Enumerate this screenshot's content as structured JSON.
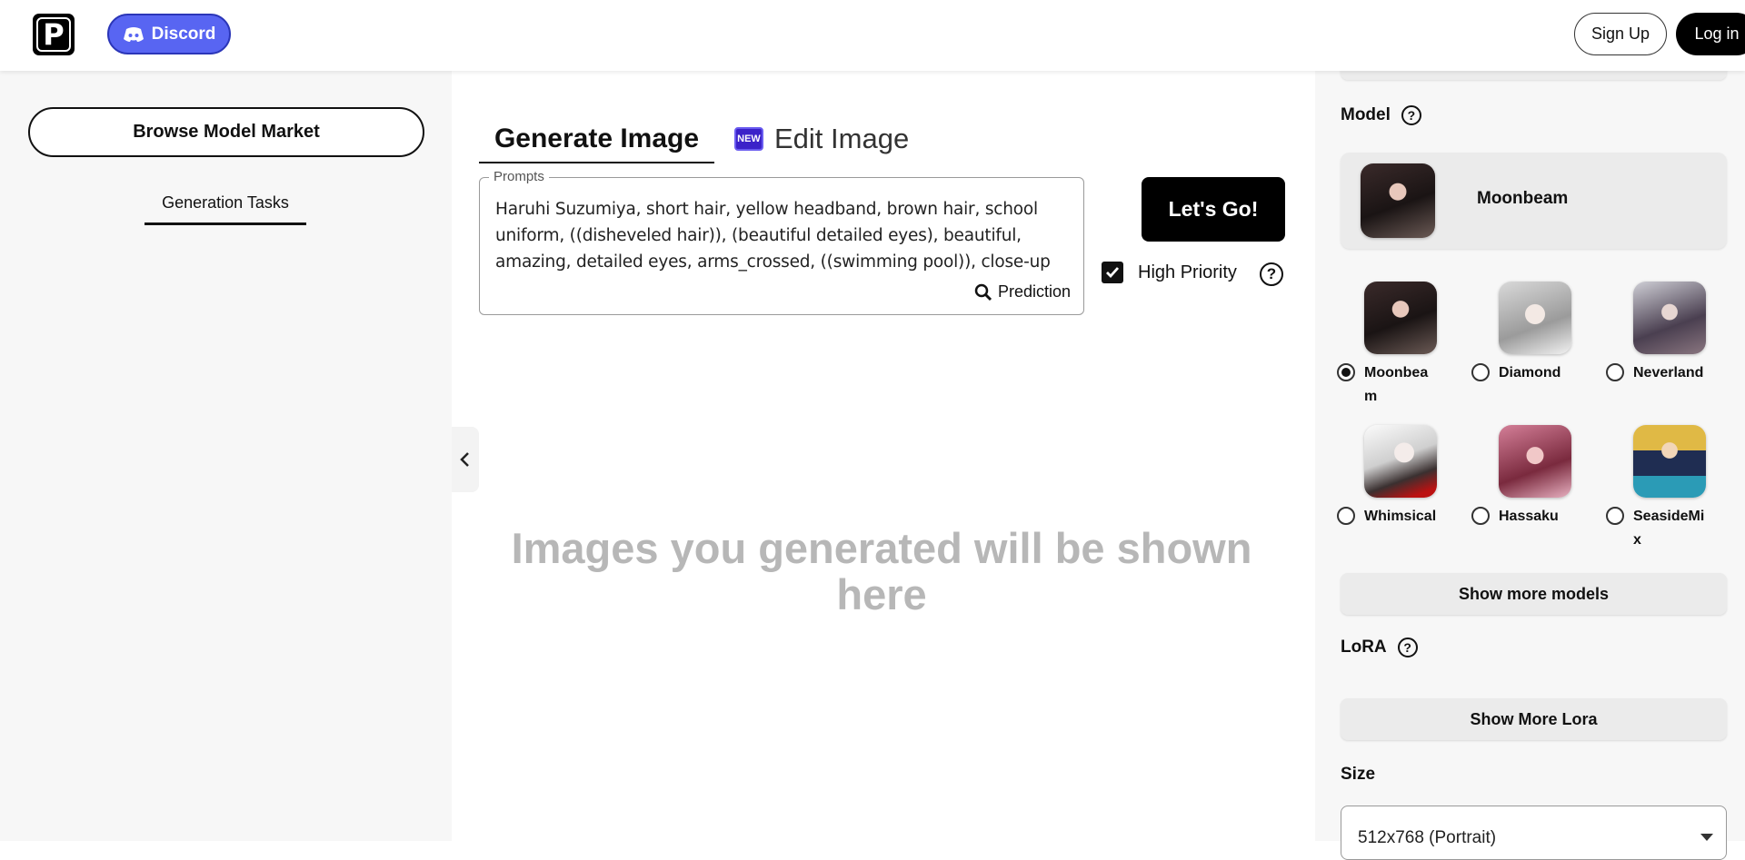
{
  "header": {
    "logo_letter": "P",
    "discord_label": "Discord",
    "signup_label": "Sign Up",
    "login_label": "Log in"
  },
  "left_panel": {
    "browse_label": "Browse Model Market",
    "tasks_tab_label": "Generation Tasks"
  },
  "main": {
    "tabs": [
      {
        "label": "Generate Image",
        "active": true
      },
      {
        "label": "Edit Image",
        "badge": "NEW",
        "active": false
      }
    ],
    "prompt_legend": "Prompts",
    "prompt_text": "Haruhi Suzumiya, short hair, yellow headband, brown hair, school uniform, ((disheveled hair)), (beautiful detailed eyes), beautiful, amazing, detailed eyes, arms_crossed, ((swimming pool)), close-up",
    "prediction_label": "Prediction",
    "go_label": "Let's Go!",
    "priority_label": "High Priority",
    "priority_checked": true,
    "help_glyph": "?",
    "placeholder": "Images you generated will be shown here"
  },
  "right_panel": {
    "model_label": "Model",
    "selected_model": "Moonbeam",
    "models": [
      {
        "name": "Moonbeam",
        "selected": true
      },
      {
        "name": "Diamond",
        "selected": false
      },
      {
        "name": "Neverland",
        "selected": false
      },
      {
        "name": "Whimsical",
        "selected": false
      },
      {
        "name": "Hassaku",
        "selected": false
      },
      {
        "name": "SeasideMix",
        "selected": false
      }
    ],
    "show_more_models": "Show more models",
    "lora_label": "LoRA",
    "show_more_lora": "Show More Lora",
    "size_label": "Size",
    "size_value": "512x768 (Portrait)"
  },
  "colors": {
    "discord": "#5865f2",
    "new_badge": "#3b22c9",
    "placeholder_text": "#b7b7b7"
  },
  "icons": {
    "discord": "discord-icon",
    "search": "search-icon",
    "collapse": "chevron-left-icon",
    "help": "help-circle-icon",
    "dropdown": "caret-down-icon"
  }
}
